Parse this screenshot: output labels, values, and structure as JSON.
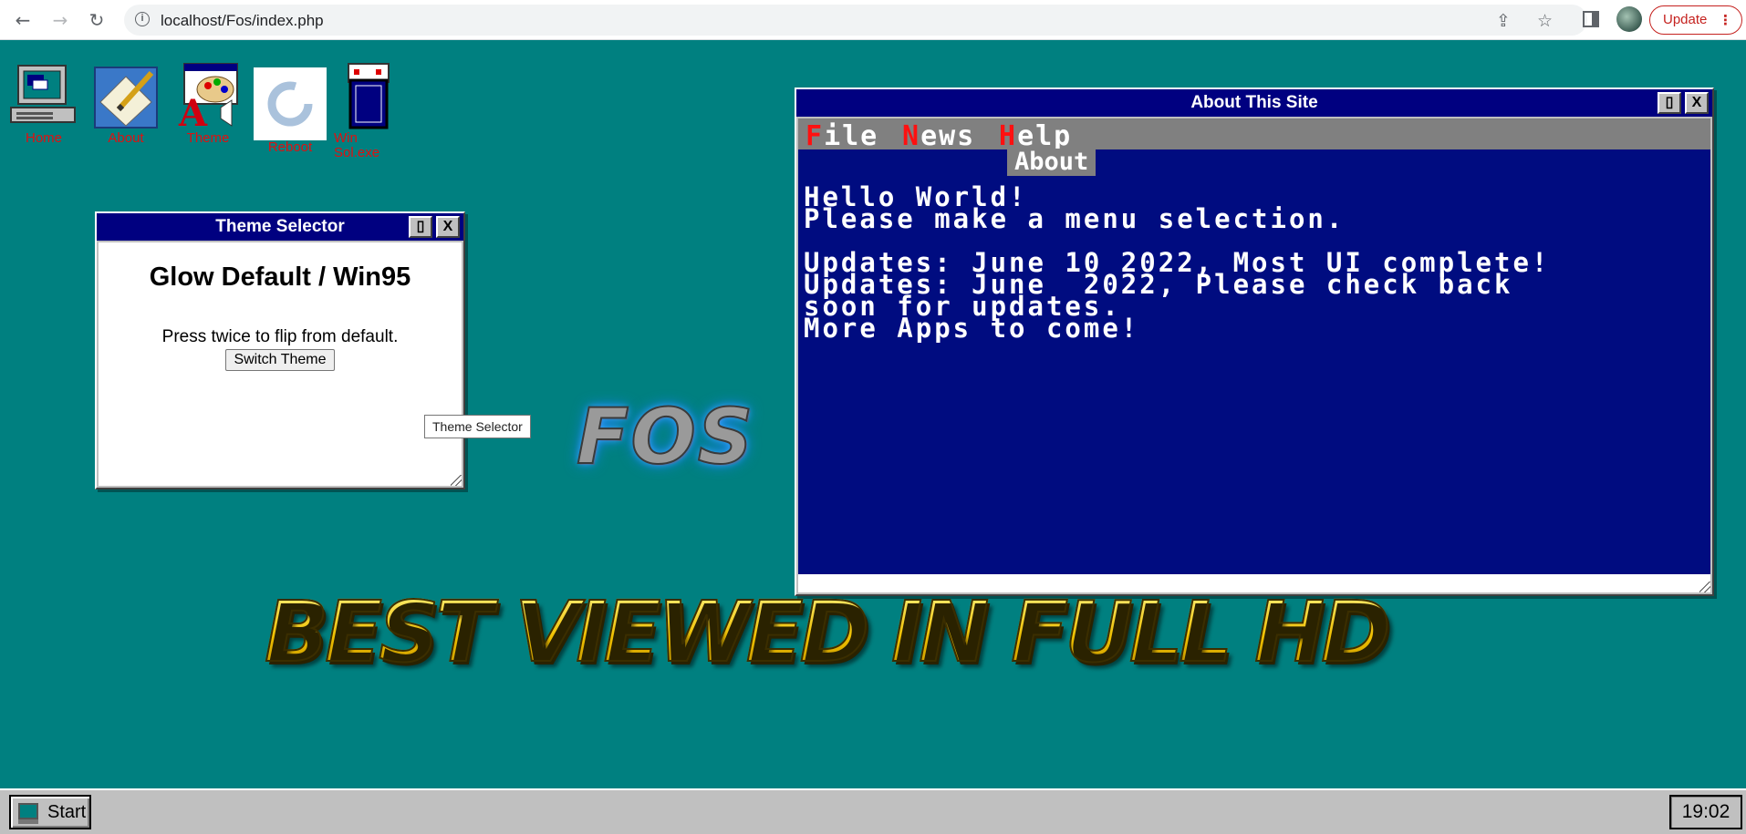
{
  "browser": {
    "url": "localhost/Fos/index.php",
    "update_label": "Update"
  },
  "desktop": {
    "icons": [
      {
        "label": "Home",
        "icon": "computer-icon"
      },
      {
        "label": "About",
        "icon": "notepad-pencil-icon"
      },
      {
        "label": "Theme",
        "icon": "paint-palette-icon"
      },
      {
        "label": "Reboot",
        "icon": "reboot-spinner-icon"
      },
      {
        "label": "Win",
        "label2": "Sol.exe",
        "icon": "solitaire-icon"
      }
    ],
    "logo_text": "FOS",
    "banner_text": "BEST VIEWED IN FULL HD"
  },
  "theme_window": {
    "title": "Theme Selector",
    "max_label": "▯",
    "close_label": "X",
    "heading": "Glow Default / Win95",
    "hint": "Press twice to flip from default.",
    "button_label": "Switch Theme",
    "tooltip": "Theme Selector"
  },
  "about_window": {
    "title": "About This Site",
    "max_label": "▯",
    "close_label": "X",
    "menu": [
      {
        "hot": "F",
        "rest": "ile"
      },
      {
        "hot": "N",
        "rest": "ews"
      },
      {
        "hot": "H",
        "rest": "elp"
      }
    ],
    "dropdown_item": "About",
    "lines": [
      "Hello World!",
      "Please make a menu selection.",
      "Updates: June 10 2022, Most UI complete!",
      "Updates: June  2022, Please check back",
      "soon for updates.",
      "More Apps to come!"
    ]
  },
  "taskbar": {
    "start_label": "Start",
    "clock": "19:02"
  },
  "colors": {
    "desktop": "#008080",
    "titlebar": "#000080",
    "terminal_bg": "#000c80",
    "hotkey": "#ff1010",
    "icon_label": "#e01010"
  }
}
